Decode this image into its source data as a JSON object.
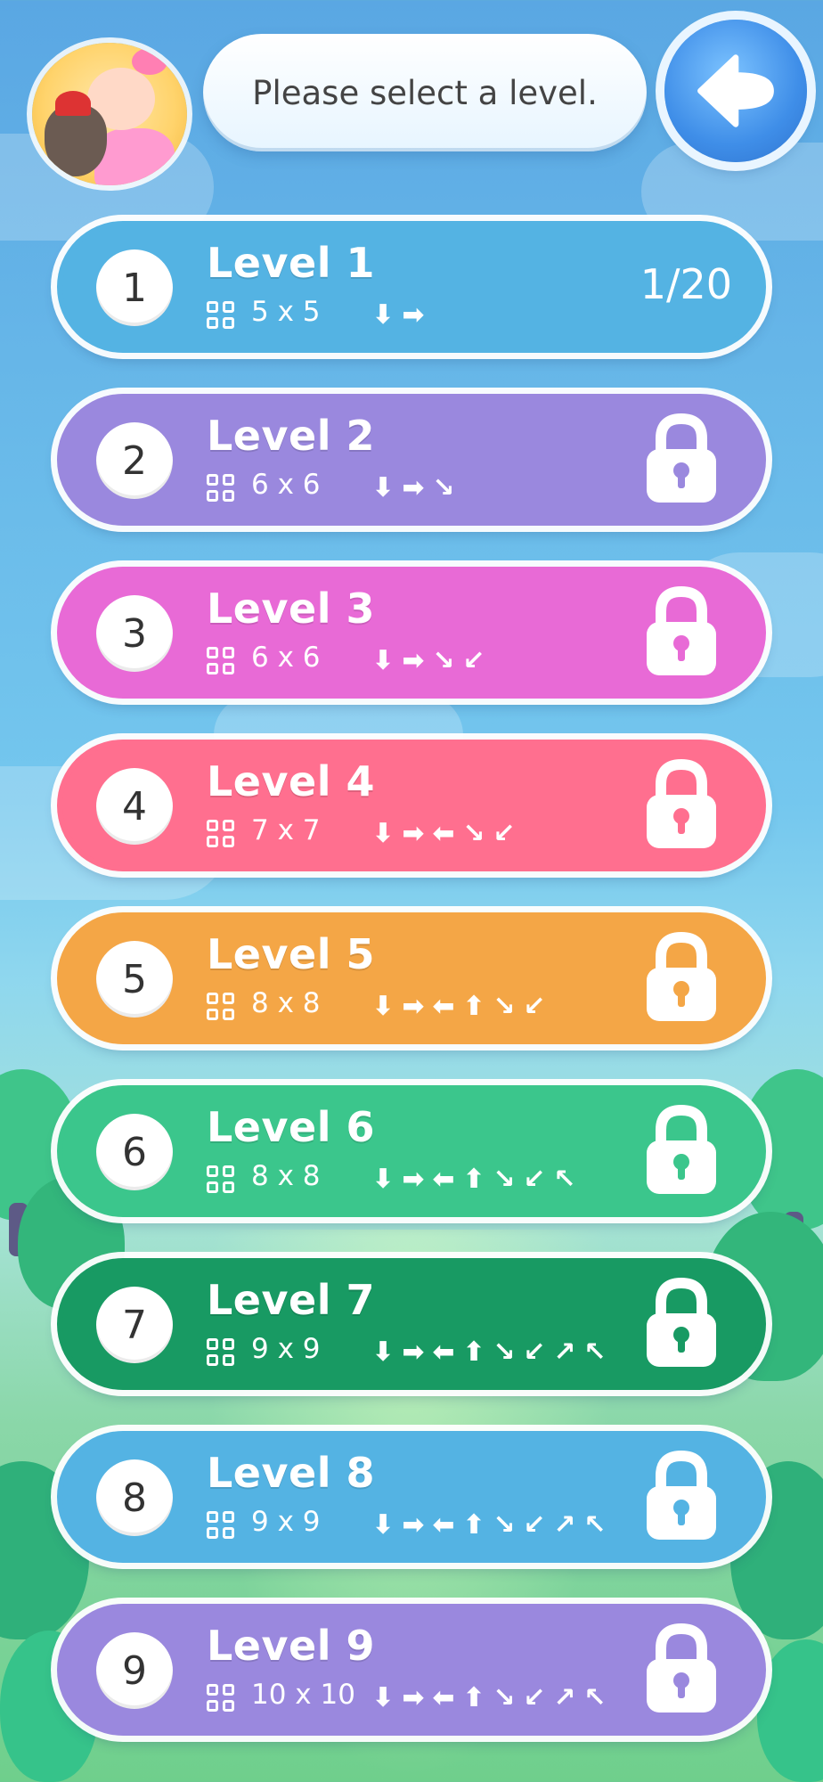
{
  "header": {
    "prompt": "Please select a level.",
    "back_icon": "back-arrow-icon",
    "avatar_icon": "character-avatar-icon"
  },
  "colors": {
    "blue": "#54b3e3",
    "purple": "#9a88de",
    "magenta": "#e86ad6",
    "pink": "#ff6f8f",
    "orange": "#f4a646",
    "teal": "#3bc68c",
    "green": "#189a63"
  },
  "levels": [
    {
      "num": "1",
      "title": "Level 1",
      "size": "5 x 5",
      "dirs": [
        "down",
        "right"
      ],
      "progress": "1/20",
      "locked": false,
      "color": "#54b3e3"
    },
    {
      "num": "2",
      "title": "Level 2",
      "size": "6 x 6",
      "dirs": [
        "down",
        "right",
        "down-right"
      ],
      "progress": "",
      "locked": true,
      "color": "#9a88de"
    },
    {
      "num": "3",
      "title": "Level 3",
      "size": "6 x 6",
      "dirs": [
        "down",
        "right",
        "down-right",
        "down-left"
      ],
      "progress": "",
      "locked": true,
      "color": "#e86ad6"
    },
    {
      "num": "4",
      "title": "Level 4",
      "size": "7 x 7",
      "dirs": [
        "down",
        "right",
        "left",
        "down-right",
        "down-left"
      ],
      "progress": "",
      "locked": true,
      "color": "#ff6f8f"
    },
    {
      "num": "5",
      "title": "Level 5",
      "size": "8 x 8",
      "dirs": [
        "down",
        "right",
        "left",
        "up",
        "down-right",
        "down-left"
      ],
      "progress": "",
      "locked": true,
      "color": "#f4a646"
    },
    {
      "num": "6",
      "title": "Level 6",
      "size": "8 x 8",
      "dirs": [
        "down",
        "right",
        "left",
        "up",
        "down-right",
        "down-left",
        "up-left"
      ],
      "progress": "",
      "locked": true,
      "color": "#3bc68c"
    },
    {
      "num": "7",
      "title": "Level 7",
      "size": "9 x 9",
      "dirs": [
        "down",
        "right",
        "left",
        "up",
        "down-right",
        "down-left",
        "up-right",
        "up-left"
      ],
      "progress": "",
      "locked": true,
      "color": "#189a63"
    },
    {
      "num": "8",
      "title": "Level 8",
      "size": "9 x 9",
      "dirs": [
        "down",
        "right",
        "left",
        "up",
        "down-right",
        "down-left",
        "up-right",
        "up-left"
      ],
      "progress": "",
      "locked": true,
      "color": "#54b3e3"
    },
    {
      "num": "9",
      "title": "Level 9",
      "size": "10 x 10",
      "dirs": [
        "down",
        "right",
        "left",
        "up",
        "down-right",
        "down-left",
        "up-right",
        "up-left"
      ],
      "progress": "",
      "locked": true,
      "color": "#9a88de"
    }
  ]
}
